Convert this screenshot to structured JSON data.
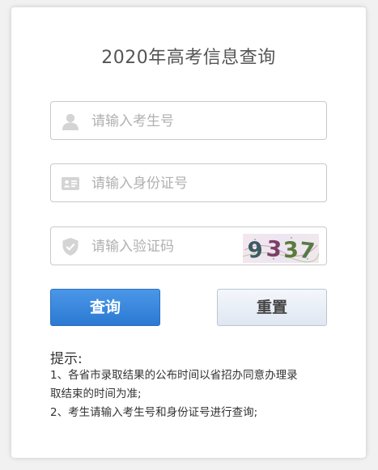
{
  "page": {
    "title": "2020年高考信息查询"
  },
  "form": {
    "exam_number": {
      "placeholder": "请输入考生号",
      "value": ""
    },
    "id_number": {
      "placeholder": "请输入身份证号",
      "value": ""
    },
    "captcha": {
      "placeholder": "请输入验证码",
      "value": "",
      "image_text": "9337"
    }
  },
  "buttons": {
    "query_label": "查询",
    "reset_label": "重置"
  },
  "tips": {
    "title": "提示:",
    "lines": [
      "1、各省市录取结果的公布时间以省招办同意办理录",
      "取结束的时间为准;",
      "2、考生请输入考生号和身份证号进行查询;"
    ]
  },
  "icons": {
    "exam_number": "user-icon",
    "id_number": "id-card-icon",
    "captcha": "shield-icon"
  },
  "colors": {
    "query_button": "#2c79d3",
    "reset_button": "#dfe7f2",
    "icon": "#d4d4d4"
  }
}
